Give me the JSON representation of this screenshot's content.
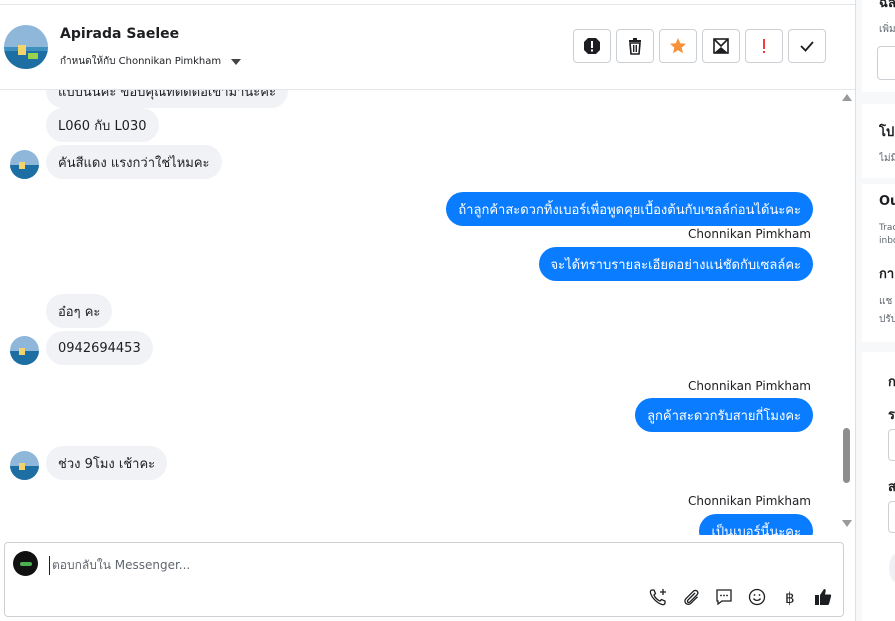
{
  "header": {
    "contact_name": "Apirada Saelee",
    "assigned_text": "กำหนดให้กับ Chonnikan Pimkham",
    "actions": [
      {
        "name": "spam-icon",
        "color": "#1c1e21"
      },
      {
        "name": "trash-icon",
        "color": "#1c1e21"
      },
      {
        "name": "star-icon",
        "color": "#f7923a"
      },
      {
        "name": "mark-unread-icon",
        "color": "#1c1e21"
      },
      {
        "name": "follow-up-icon",
        "color": "#fa383e"
      },
      {
        "name": "check-icon",
        "color": "#1c1e21"
      }
    ]
  },
  "messages": {
    "m1_partial": "แบบนั้นค่ะ ขอบคุณที่ติดต่อเข้ามานะคะ",
    "m2": "L060 กับ L030",
    "m3": "คันสีแดง แรงกว่าใช่ไหมคะ",
    "m4": "ถ้าลูกค้าสะดวกทิ้งเบอร์เพื่อพูดคุยเบื้องต้นกับเซลล์ก่อนได้นะคะ",
    "sender": "Chonnikan Pimkham",
    "m5": "จะได้ทราบรายละเอียดอย่างแน่ชัดกับเซลล์คะ",
    "m6": "อ๋อๆ คะ",
    "m7": "0942694453",
    "m8": "ลูกค้าสะดวกรับสายกี่โมงคะ",
    "m9": "ช่วง 9โมง เช้าคะ",
    "m10_partial": "เป็นเบอร์นี้นะคะ"
  },
  "composer": {
    "placeholder": "ตอบกลับใน Messenger...",
    "tools": [
      "call-add-icon",
      "attachment-icon",
      "saved-reply-icon",
      "emoji-icon",
      "baht-icon",
      "like-icon"
    ]
  },
  "right_panel": {
    "t1": "ฉล",
    "t2": "เพิ่ม",
    "t3": "โป",
    "t4": "ไม่มี",
    "t5": "Ou",
    "t6": "Trac",
    "t7": "inbo",
    "t8": "กา",
    "t9": "แช",
    "t10": "ปรับ",
    "t11": "ก",
    "t12": "ร",
    "t13": "ส"
  },
  "colors": {
    "outgoing_bubble": "#0a7cff",
    "incoming_bubble": "#f0f2f5",
    "like_blue": "#1c1e21"
  }
}
